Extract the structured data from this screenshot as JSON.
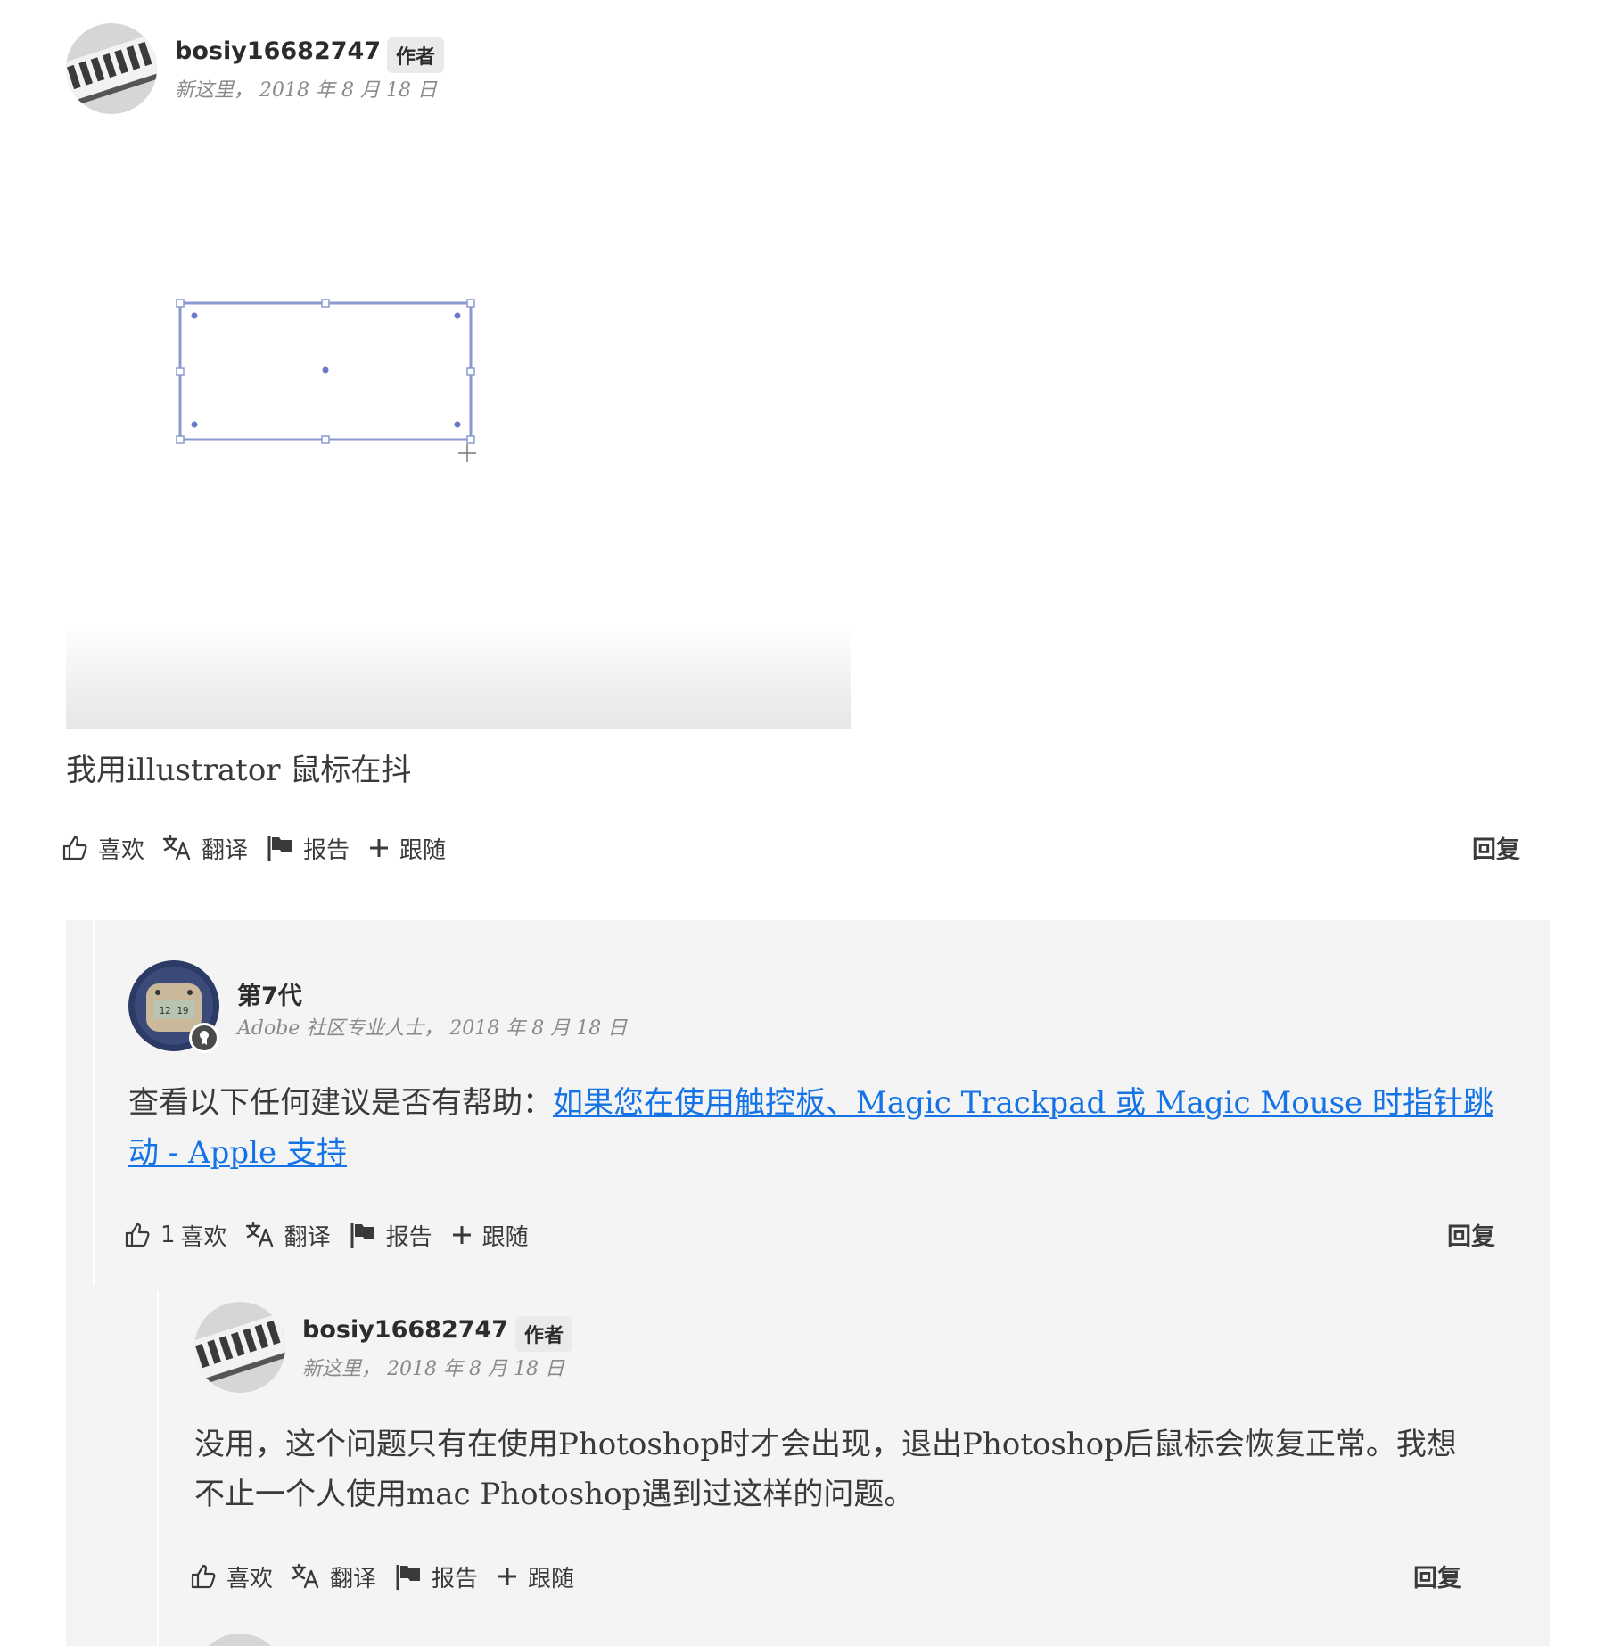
{
  "posts": [
    {
      "username": "bosiy16682747",
      "badge": "作者",
      "meta": "新这里， 2018 年 8 月 18 日",
      "body": "我用illustrator 鼠标在抖",
      "like_label": "喜欢",
      "translate_label": "翻译",
      "report_label": "报告",
      "follow_label": "跟随",
      "reply_label": "回复"
    },
    {
      "username": "第7代",
      "meta": "Adobe 社区专业人士， 2018 年 8 月 18 日",
      "body_prefix": "查看以下任何建议是否有帮助：",
      "link_text": "如果您在使用触控板、Magic Trackpad 或 Magic Mouse 时指针跳动 - Apple 支持",
      "like_count": "1",
      "like_label": "喜欢",
      "translate_label": "翻译",
      "report_label": "报告",
      "follow_label": "跟随",
      "reply_label": "回复"
    },
    {
      "username": "bosiy16682747",
      "badge": "作者",
      "meta": "新这里， 2018 年 8 月 18 日",
      "body": "没用，这个问题只有在使用Photoshop时才会出现，退出Photoshop后鼠标会恢复正常。我想不止一个人使用mac Photoshop遇到过这样的问题。",
      "like_label": "喜欢",
      "translate_label": "翻译",
      "report_label": "报告",
      "follow_label": "跟随",
      "reply_label": "回复"
    }
  ],
  "icons": {
    "like": "thumbs-up-icon",
    "translate": "translate-icon",
    "report": "flag-icon",
    "follow": "plus-icon"
  },
  "colors": {
    "link": "#1473e6",
    "panel": "#f4f4f4",
    "badge": "#eaeaea"
  }
}
